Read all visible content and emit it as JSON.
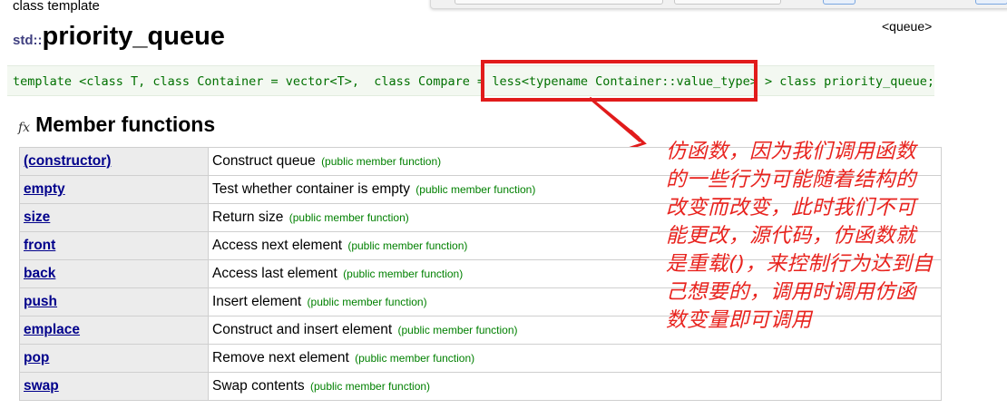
{
  "page": {
    "class_label": "class template",
    "header_tag": "<queue>",
    "title": {
      "namespace": "std::",
      "name": "priority_queue"
    },
    "declaration": {
      "prefix": "template <class T, class Container = vector<T>,  class Compare = ",
      "highlighted": "less<typename Container::value_type>",
      "suffix": " > class priority_queue;"
    }
  },
  "section": {
    "icon": "fx",
    "title": "Member functions"
  },
  "members": [
    {
      "name": "(constructor)",
      "description": "Construct queue",
      "kind": "(public member function)"
    },
    {
      "name": "empty",
      "description": "Test whether container is empty",
      "kind": "(public member function)"
    },
    {
      "name": "size",
      "description": "Return size",
      "kind": "(public member function)"
    },
    {
      "name": "front",
      "description": "Access next element",
      "kind": "(public member function)"
    },
    {
      "name": "back",
      "description": "Access last element",
      "kind": "(public member function)"
    },
    {
      "name": "push",
      "description": "Insert element",
      "kind": "(public member function)"
    },
    {
      "name": "emplace",
      "description": "Construct and insert element",
      "kind": "(public member function)"
    },
    {
      "name": "pop",
      "description": "Remove next element",
      "kind": "(public member function)"
    },
    {
      "name": "swap",
      "description": "Swap contents",
      "kind": "(public member function)"
    }
  ],
  "annotation": {
    "lines": [
      "仿函数，因为我们调用函数",
      "的一些行为可能随着结构的",
      "改变而改变，此时我们不可",
      "能更改，源代码，仿函数就",
      "是重载()，来控制行为达到自",
      "己想要的，调用时调用仿函",
      "数变量即可调用"
    ]
  },
  "colors": {
    "annotation_red": "#e8231e",
    "code_green": "#007000",
    "link_blue": "#00008b",
    "kind_green": "#008000",
    "highlight_box": "#e11b1b"
  }
}
